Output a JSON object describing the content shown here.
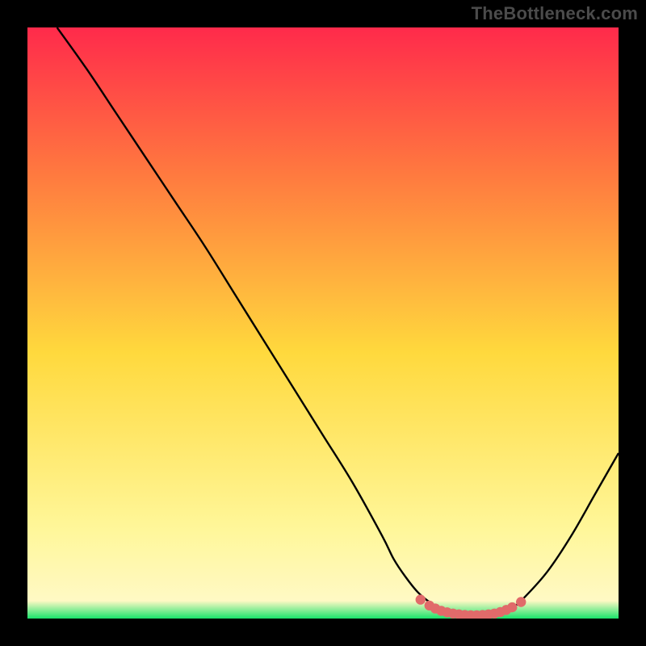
{
  "watermark": "TheBottleneck.com",
  "colors": {
    "bg": "#000000",
    "watermark": "#4b4b4b",
    "curve": "#000000",
    "marker": "#e16a6a",
    "gradient_top": "#ff2a4b",
    "gradient_mid1": "#ff7a3f",
    "gradient_mid2": "#ffd93d",
    "gradient_low": "#fff79a",
    "gradient_bottom": "#19e36b"
  },
  "chart_data": {
    "type": "line",
    "title": "",
    "xlabel": "",
    "ylabel": "",
    "xlim": [
      0,
      100
    ],
    "ylim": [
      0,
      100
    ],
    "grid": false,
    "legend": false,
    "series": [
      {
        "name": "bottleneck-curve",
        "x": [
          5,
          10,
          15,
          20,
          25,
          30,
          35,
          40,
          45,
          50,
          55,
          60,
          62,
          64,
          66,
          68,
          70,
          72,
          74,
          76,
          78,
          80,
          82,
          84,
          88,
          92,
          96,
          100
        ],
        "y": [
          100,
          93,
          85.5,
          78,
          70.5,
          63,
          55,
          47,
          39,
          31,
          23,
          14,
          10,
          7,
          4.5,
          2.8,
          1.6,
          0.9,
          0.5,
          0.4,
          0.5,
          0.9,
          1.8,
          3.5,
          8,
          14,
          21,
          28
        ]
      }
    ],
    "markers": {
      "name": "optimal-range",
      "x": [
        66.5,
        68,
        69,
        70,
        71,
        72,
        73,
        74,
        75,
        76,
        77,
        78,
        79,
        80,
        81,
        82,
        83.5
      ],
      "y": [
        3.2,
        2.2,
        1.7,
        1.3,
        1.05,
        0.85,
        0.7,
        0.6,
        0.55,
        0.55,
        0.6,
        0.7,
        0.85,
        1.1,
        1.45,
        1.9,
        2.8
      ]
    },
    "gradient_stops": [
      {
        "offset": 0.0,
        "color": "#ff2a4b"
      },
      {
        "offset": 0.25,
        "color": "#ff7a3f"
      },
      {
        "offset": 0.55,
        "color": "#ffd93d"
      },
      {
        "offset": 0.85,
        "color": "#fff79a"
      },
      {
        "offset": 0.97,
        "color": "#fff9c4"
      },
      {
        "offset": 1.0,
        "color": "#19e36b"
      }
    ]
  }
}
